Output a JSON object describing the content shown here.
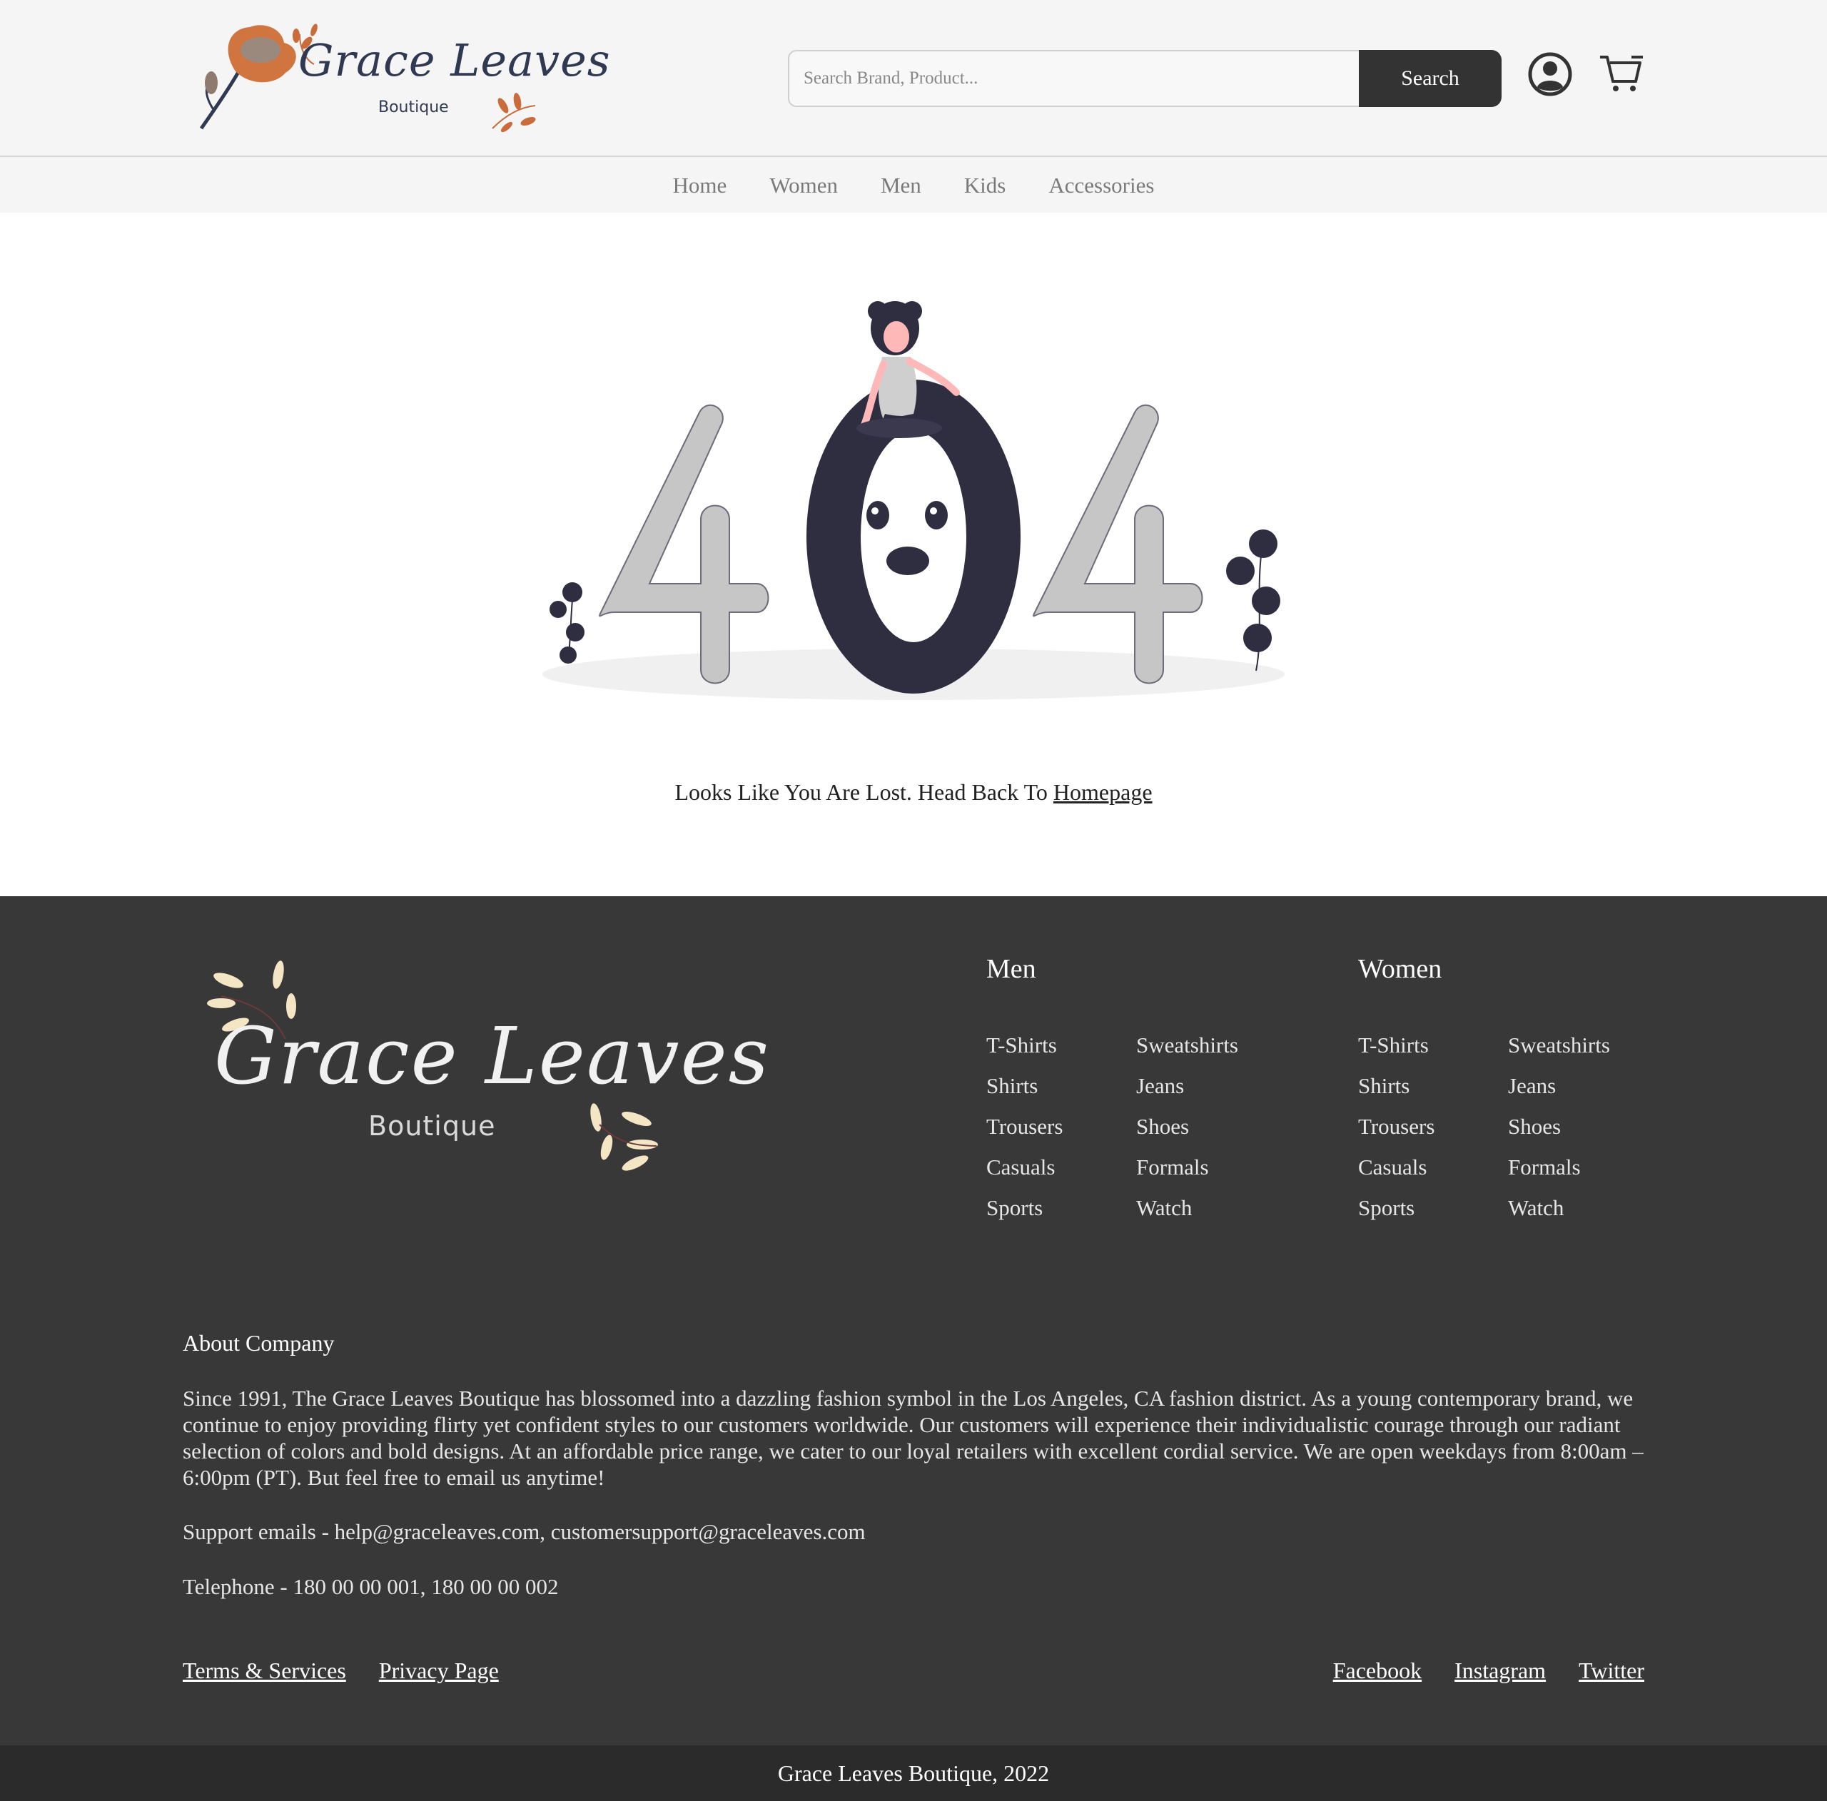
{
  "brand": {
    "name_script": "Grace Leaves",
    "name_sub": "Boutique",
    "accent": "#c96b3a",
    "ink": "#2f3a52"
  },
  "header": {
    "search_placeholder": "Search Brand, Product...",
    "search_label": "Search",
    "icons": [
      "user-account-icon",
      "shopping-cart-icon"
    ]
  },
  "nav": {
    "items": [
      "Home",
      "Women",
      "Men",
      "Kids",
      "Accessories"
    ]
  },
  "main": {
    "error_code": "404",
    "message": "Looks Like You Are Lost. Head Back To ",
    "homepage_link": "Homepage"
  },
  "footer": {
    "men": {
      "title": "Men",
      "col1": [
        "T-Shirts",
        "Shirts",
        "Trousers",
        "Casuals",
        "Sports"
      ],
      "col2": [
        "Sweatshirts",
        "Jeans",
        "Shoes",
        "Formals",
        "Watch"
      ]
    },
    "women": {
      "title": "Women",
      "col1": [
        "T-Shirts",
        "Shirts",
        "Trousers",
        "Casuals",
        "Sports"
      ],
      "col2": [
        "Sweatshirts",
        "Jeans",
        "Shoes",
        "Formals",
        "Watch"
      ]
    },
    "about_title": "About Company",
    "about_text": "Since 1991, The Grace Leaves Boutique has blossomed into a dazzling fashion symbol in the Los Angeles, CA fashion district. As a young contemporary brand, we continue to enjoy providing flirty yet confident styles to our customers worldwide. Our customers will experience their individualistic courage through our radiant selection of colors and bold designs. At an affordable price range, we cater to our loyal retailers with excellent cordial service. We are open weekdays from 8:00am – 6:00pm (PT). But feel free to email us anytime!",
    "support": "Support emails - help@graceleaves.com, customersupport@graceleaves.com",
    "telephone": "Telephone - 180 00 00 001, 180 00 00 002",
    "legal_links": [
      "Terms & Services",
      "Privacy Page"
    ],
    "social_links": [
      "Facebook",
      "Instagram",
      "Twitter"
    ],
    "copyright": "Grace Leaves Boutique, 2022",
    "bg": "#383838"
  }
}
